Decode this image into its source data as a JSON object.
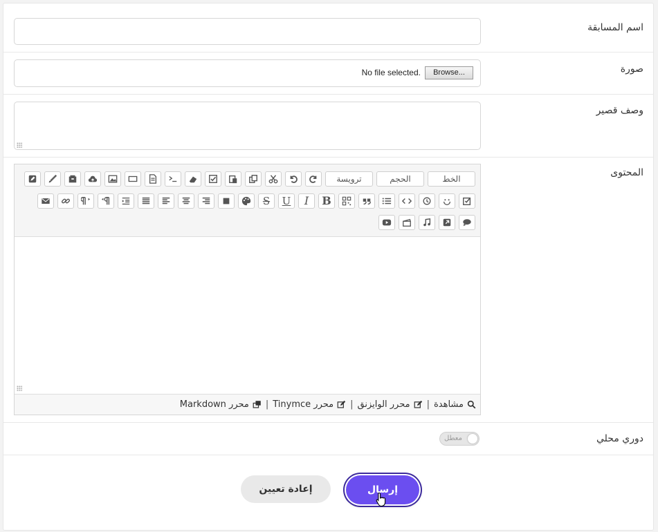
{
  "form": {
    "name_label": "اسم المسابقة",
    "image_label": "صورة",
    "browse_label": "Browse...",
    "no_file_text": "No file selected.",
    "desc_label": "وصف قصير",
    "content_label": "المحتوى",
    "local_league_label": "دوري محلي",
    "toggle_state": "معطل"
  },
  "toolbar": {
    "font_label": "الخط",
    "size_label": "الحجم",
    "heading_label": "ترويسة",
    "bold_glyph": "B",
    "italic_glyph": "I",
    "underline_glyph": "U",
    "strike_glyph": "S"
  },
  "editor_footer": {
    "preview": "مشاهدة",
    "wysiwyg": "محرر الوايزنق",
    "tinymce": "محرر Tinymce",
    "markdown": "محرر Markdown",
    "separator": "|"
  },
  "actions": {
    "submit": "إرسال",
    "reset": "إعادة تعيين"
  },
  "colors": {
    "accent": "#6b4ef0",
    "accent_border": "#3c2a9c"
  }
}
